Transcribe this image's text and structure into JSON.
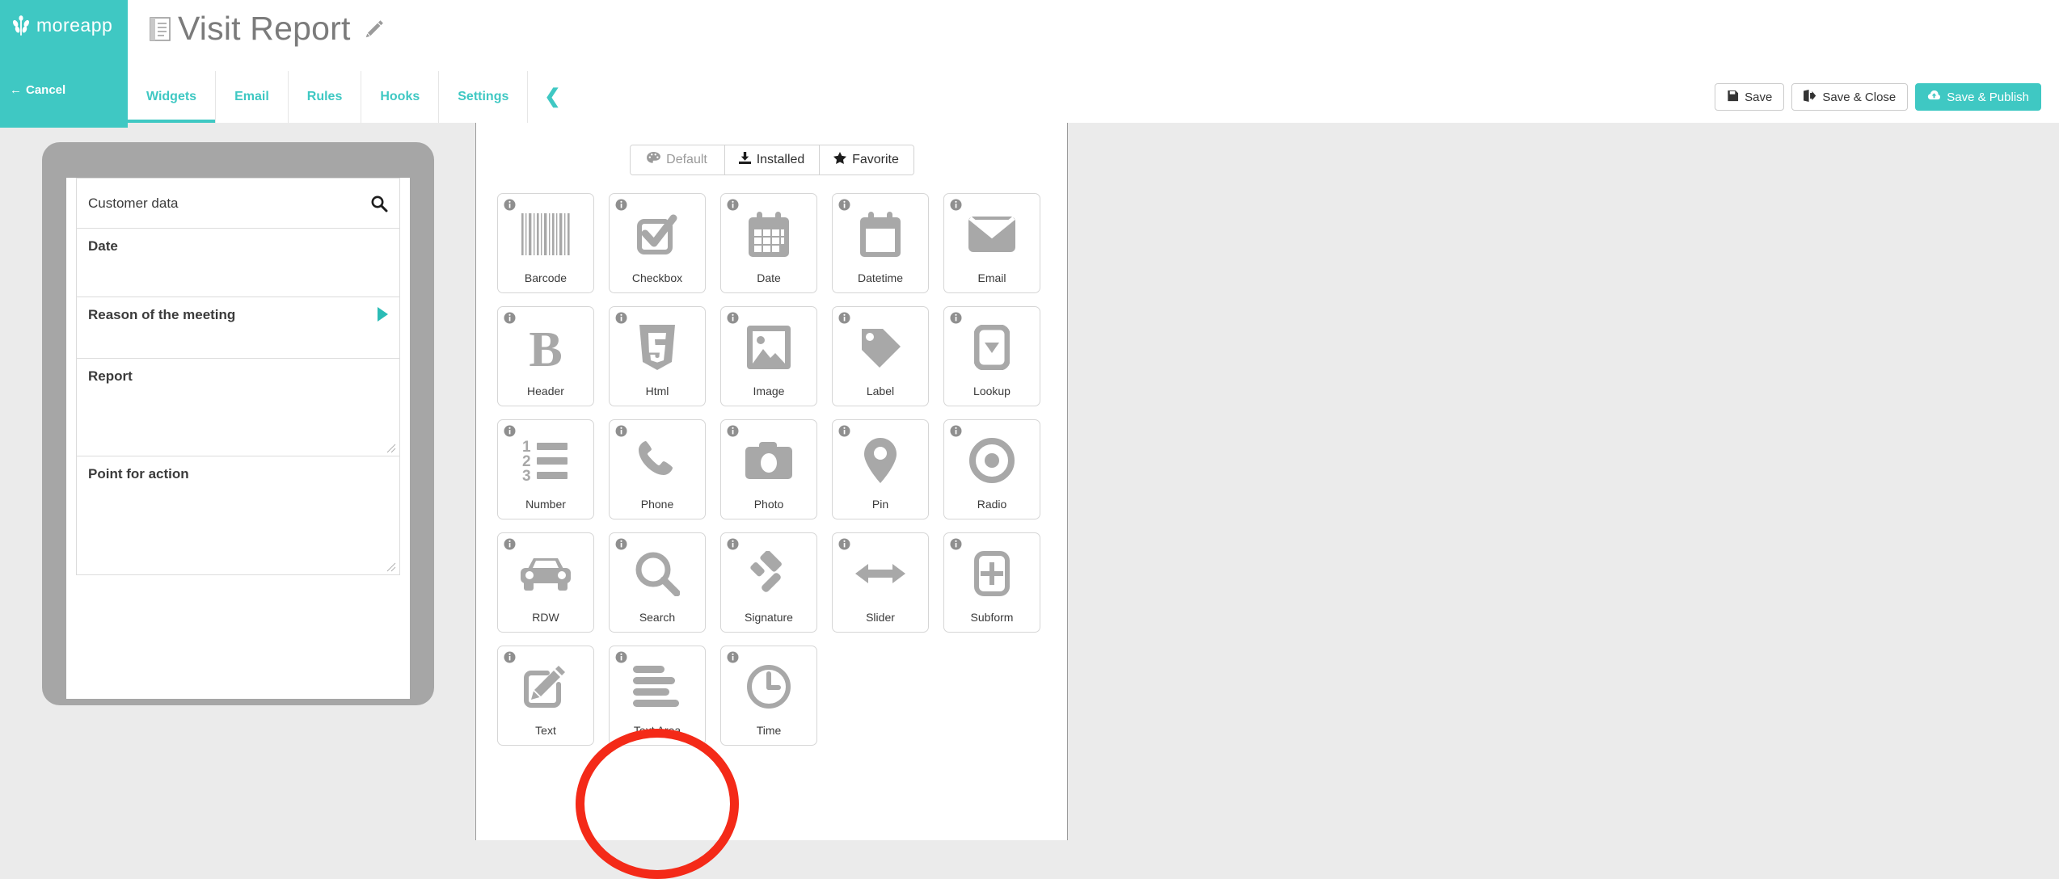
{
  "brand": {
    "name": "moreapp",
    "logo_icon": "wheat-logo-icon",
    "color": "#3fc8c3"
  },
  "header": {
    "cancel_label": "Cancel",
    "cancel_icon": "arrow-left-icon",
    "title": "Visit Report",
    "title_icon": "document-icon",
    "edit_icon": "pencil-icon",
    "collapse_icon": "chevron-left-icon",
    "tabs": [
      {
        "label": "Widgets",
        "active": true
      },
      {
        "label": "Email",
        "active": false
      },
      {
        "label": "Rules",
        "active": false
      },
      {
        "label": "Hooks",
        "active": false
      },
      {
        "label": "Settings",
        "active": false
      }
    ],
    "actions": [
      {
        "label": "Save",
        "icon": "floppy-disk-icon",
        "primary": false
      },
      {
        "label": "Save & Close",
        "icon": "sign-out-icon",
        "primary": false
      },
      {
        "label": "Save & Publish",
        "icon": "cloud-upload-icon",
        "primary": true
      }
    ]
  },
  "preview": {
    "rows": [
      {
        "label": "Customer data",
        "type": "search",
        "icon": "search-icon"
      },
      {
        "label": "Date",
        "type": "date"
      },
      {
        "label": "Reason of the meeting",
        "type": "navigate",
        "icon": "play-arrow-icon"
      },
      {
        "label": "Report",
        "type": "textarea"
      },
      {
        "label": "Point for action",
        "type": "textarea"
      }
    ]
  },
  "widget_panel": {
    "filters": [
      {
        "label": "Default",
        "icon": "palette-icon",
        "active": false
      },
      {
        "label": "Installed",
        "icon": "download-icon",
        "active": false
      },
      {
        "label": "Favorite",
        "icon": "star-icon",
        "active": false
      }
    ],
    "widgets": [
      {
        "label": "Barcode",
        "icon": "barcode-icon"
      },
      {
        "label": "Checkbox",
        "icon": "checkbox-icon"
      },
      {
        "label": "Date",
        "icon": "calendar-icon"
      },
      {
        "label": "Datetime",
        "icon": "calendar-blank-icon"
      },
      {
        "label": "Email",
        "icon": "envelope-icon"
      },
      {
        "label": "Header",
        "icon": "bold-b-icon"
      },
      {
        "label": "Html",
        "icon": "html5-icon"
      },
      {
        "label": "Image",
        "icon": "image-icon"
      },
      {
        "label": "Label",
        "icon": "tag-icon"
      },
      {
        "label": "Lookup",
        "icon": "dropdown-icon"
      },
      {
        "label": "Number",
        "icon": "numbered-list-icon"
      },
      {
        "label": "Phone",
        "icon": "phone-icon"
      },
      {
        "label": "Photo",
        "icon": "camera-icon"
      },
      {
        "label": "Pin",
        "icon": "map-pin-icon"
      },
      {
        "label": "Radio",
        "icon": "radio-button-icon"
      },
      {
        "label": "RDW",
        "icon": "car-icon"
      },
      {
        "label": "Search",
        "icon": "magnifier-icon"
      },
      {
        "label": "Signature",
        "icon": "gavel-icon"
      },
      {
        "label": "Slider",
        "icon": "arrows-horizontal-icon"
      },
      {
        "label": "Subform",
        "icon": "plus-box-icon"
      },
      {
        "label": "Text",
        "icon": "pencil-box-icon"
      },
      {
        "label": "Text Area",
        "icon": "text-lines-icon"
      },
      {
        "label": "Time",
        "icon": "clock-icon"
      }
    ],
    "info_badge_icon": "info-icon"
  },
  "annotation": {
    "shape": "circle",
    "color": "#f42a18",
    "targets": "Text Area"
  }
}
